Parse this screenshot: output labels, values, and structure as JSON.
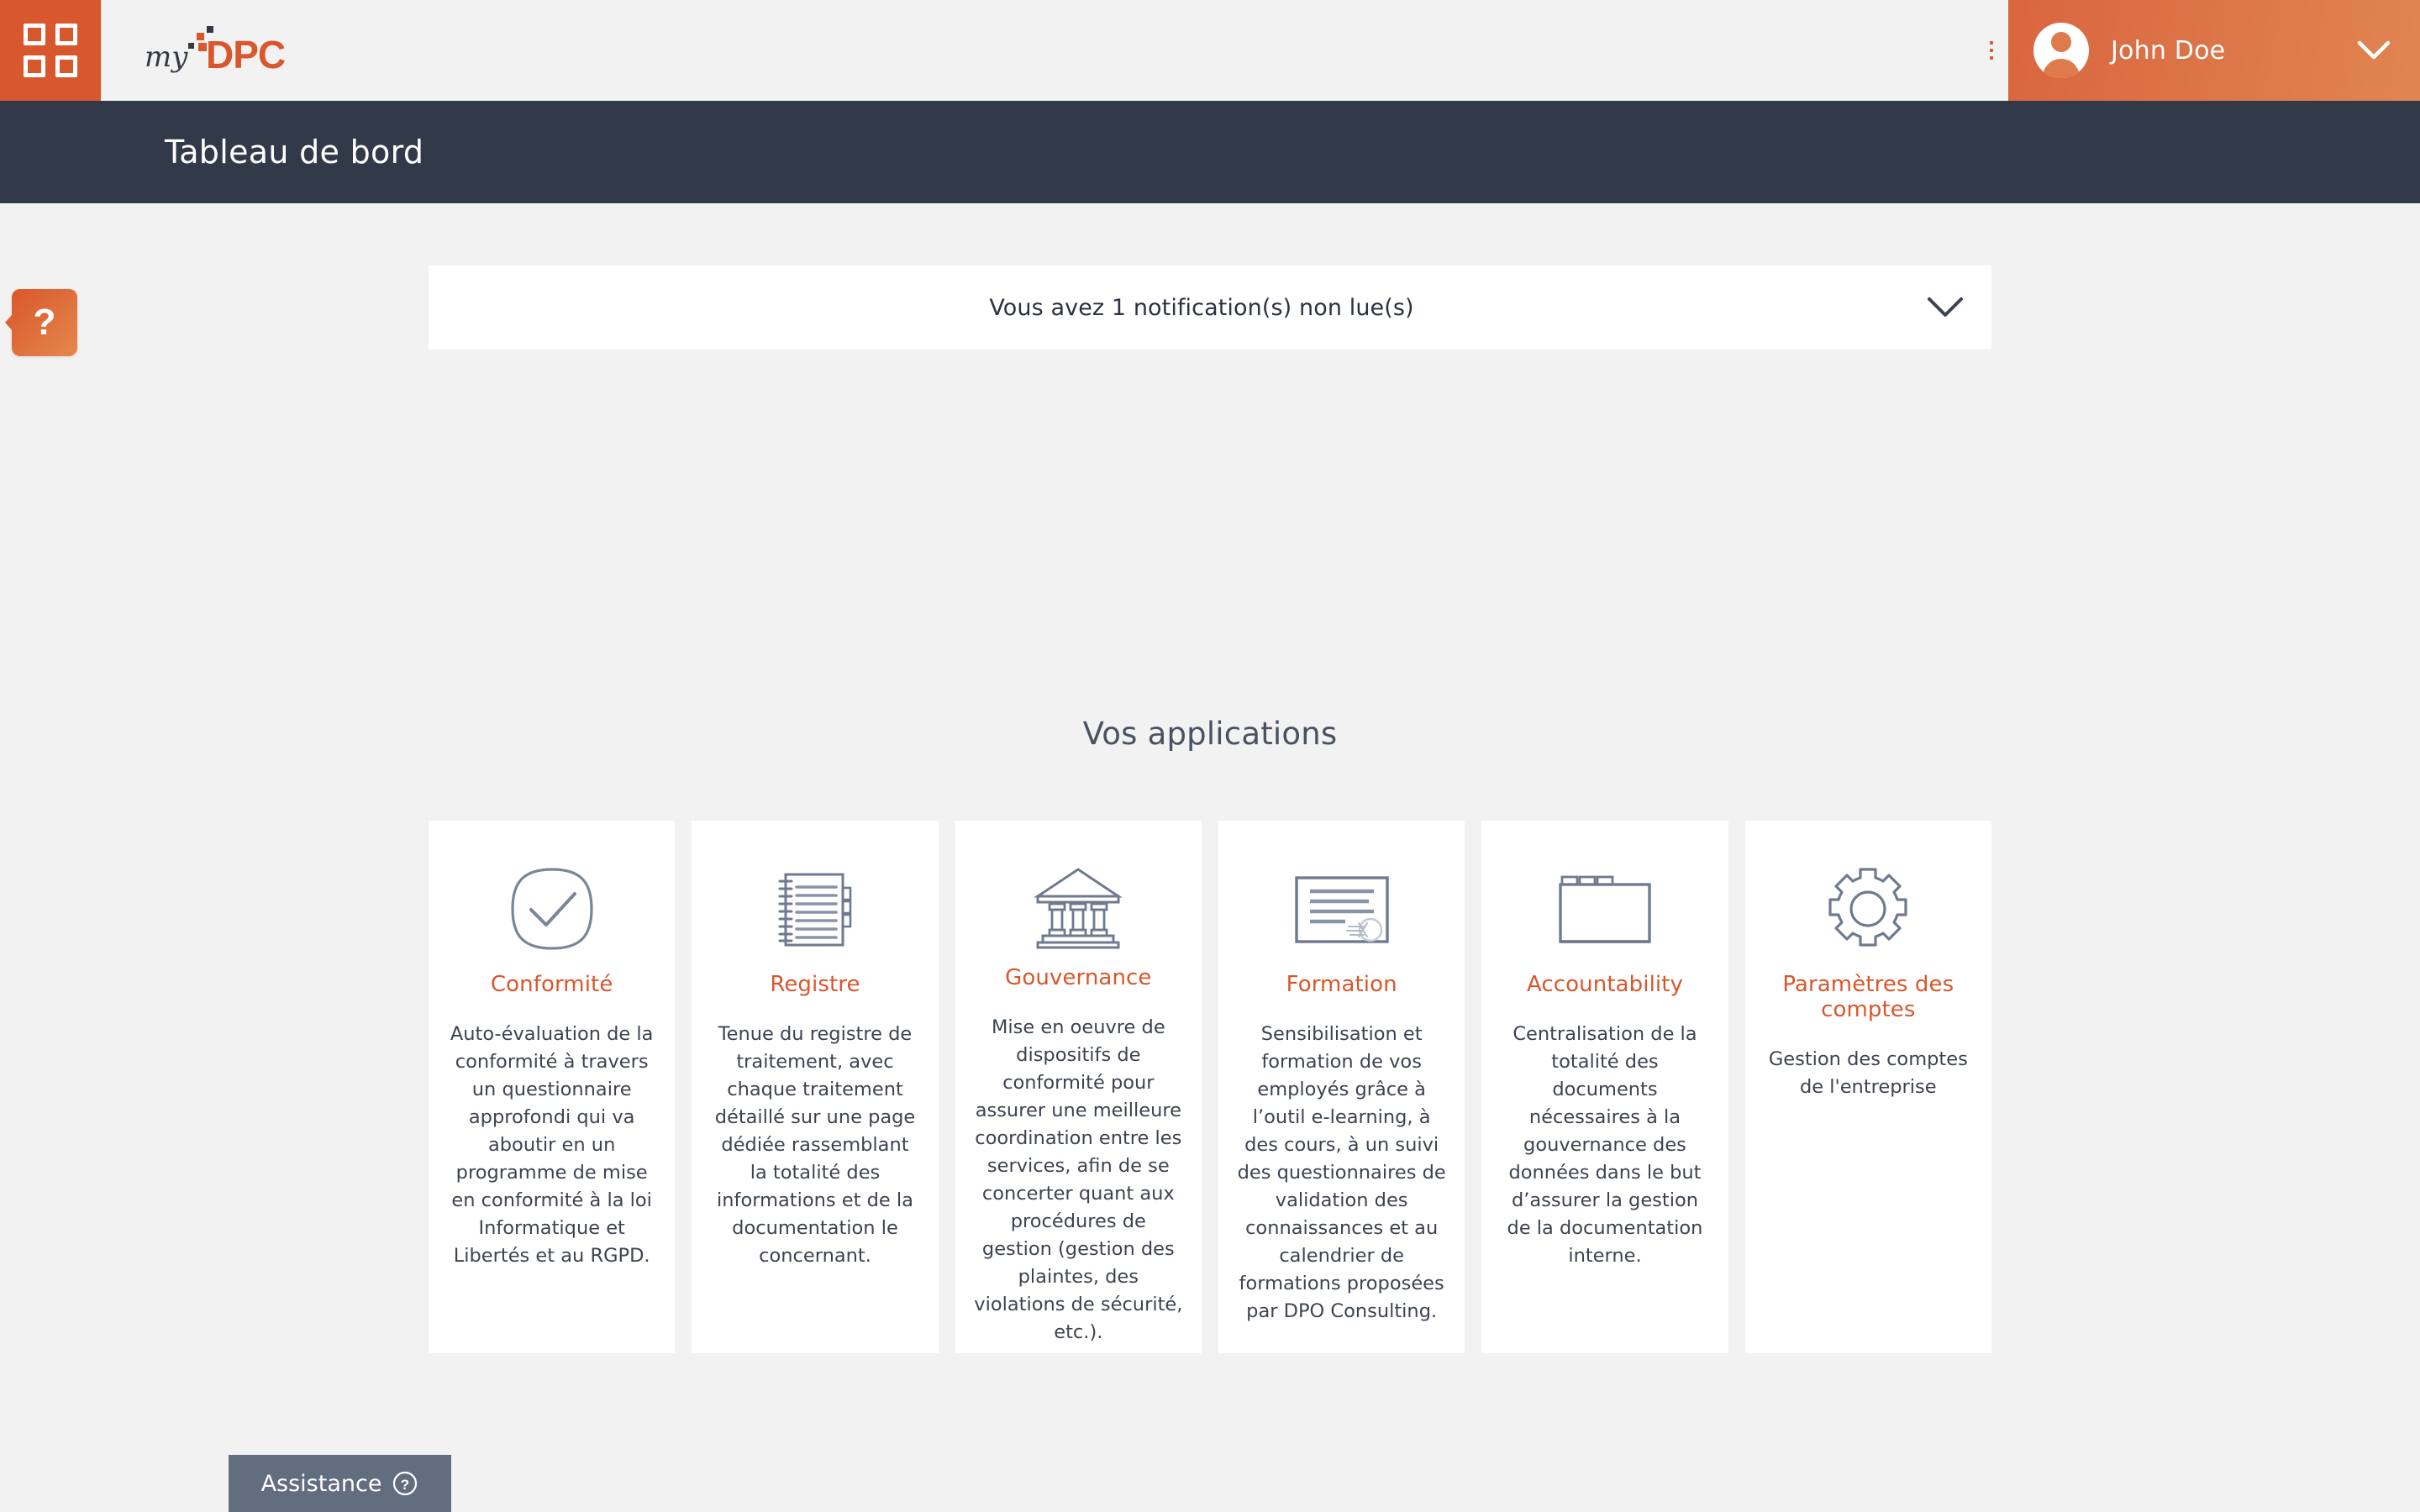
{
  "brand": {
    "name": "myDPC",
    "prefix": "my",
    "suffix": "DPC",
    "grid_launcher_label": "Applications"
  },
  "colors": {
    "accent_orange": "#d9572c",
    "title_orange": "#d9572c",
    "dark_navy": "#323a4a",
    "page_bg": "#f2f2f2",
    "card_bg": "#ffffff",
    "icon_stroke": "#6f7a90",
    "assistance_bg": "#636d80",
    "user_gradient_start": "#d9653f",
    "user_gradient_end": "#e08552"
  },
  "header": {
    "user_name": "John Doe",
    "avatar_icon": "user-avatar-icon",
    "caret_icon": "chevron-down-icon",
    "grid_icon": "grid-apps-icon"
  },
  "page": {
    "title": "Tableau de bord"
  },
  "help_tab": {
    "glyph": "?",
    "icon": "question-mark-icon"
  },
  "notification": {
    "text": "Vous avez 1 notification(s) non lue(s)",
    "count": 1,
    "caret_icon": "chevron-down-icon"
  },
  "apps_section": {
    "heading": "Vos applications",
    "cards": [
      {
        "title": "Conformité",
        "icon": "check-squircle-icon",
        "description": "Auto-évaluation de la conformité à travers un questionnaire approfondi qui va aboutir en un programme de mise en conformité à la loi Informatique et Libertés et au RGPD."
      },
      {
        "title": "Registre",
        "icon": "spiral-notebook-icon",
        "description": "Tenue du registre de traitement, avec chaque traitement détaillé sur une page dédiée rassemblant la totalité des informations et de la documentation le concernant."
      },
      {
        "title": "Gouvernance",
        "icon": "bank-building-icon",
        "description": "Mise en oeuvre de dispositifs de conformité pour assurer une meilleure coordination entre les services, afin de se concerter quant aux procédures de gestion (gestion des plaintes, des violations de sécurité, etc.)."
      },
      {
        "title": "Formation",
        "icon": "certificate-icon",
        "description": "Sensibilisation et formation de vos employés grâce à l’outil e-learning, à des cours, à un suivi des questionnaires de validation des connaissances et au calendrier de formations proposées par DPO Consulting."
      },
      {
        "title": "Accountability",
        "icon": "folder-box-icon",
        "description": "Centralisation de la totalité des documents nécessaires à la gouvernance des données dans le but d’assurer la gestion de la documentation interne."
      },
      {
        "title": "Paramètres des comptes",
        "icon": "gear-icon",
        "description": "Gestion des comptes de l'entreprise"
      }
    ]
  },
  "assistance": {
    "label": "Assistance",
    "icon": "question-circle-icon"
  }
}
